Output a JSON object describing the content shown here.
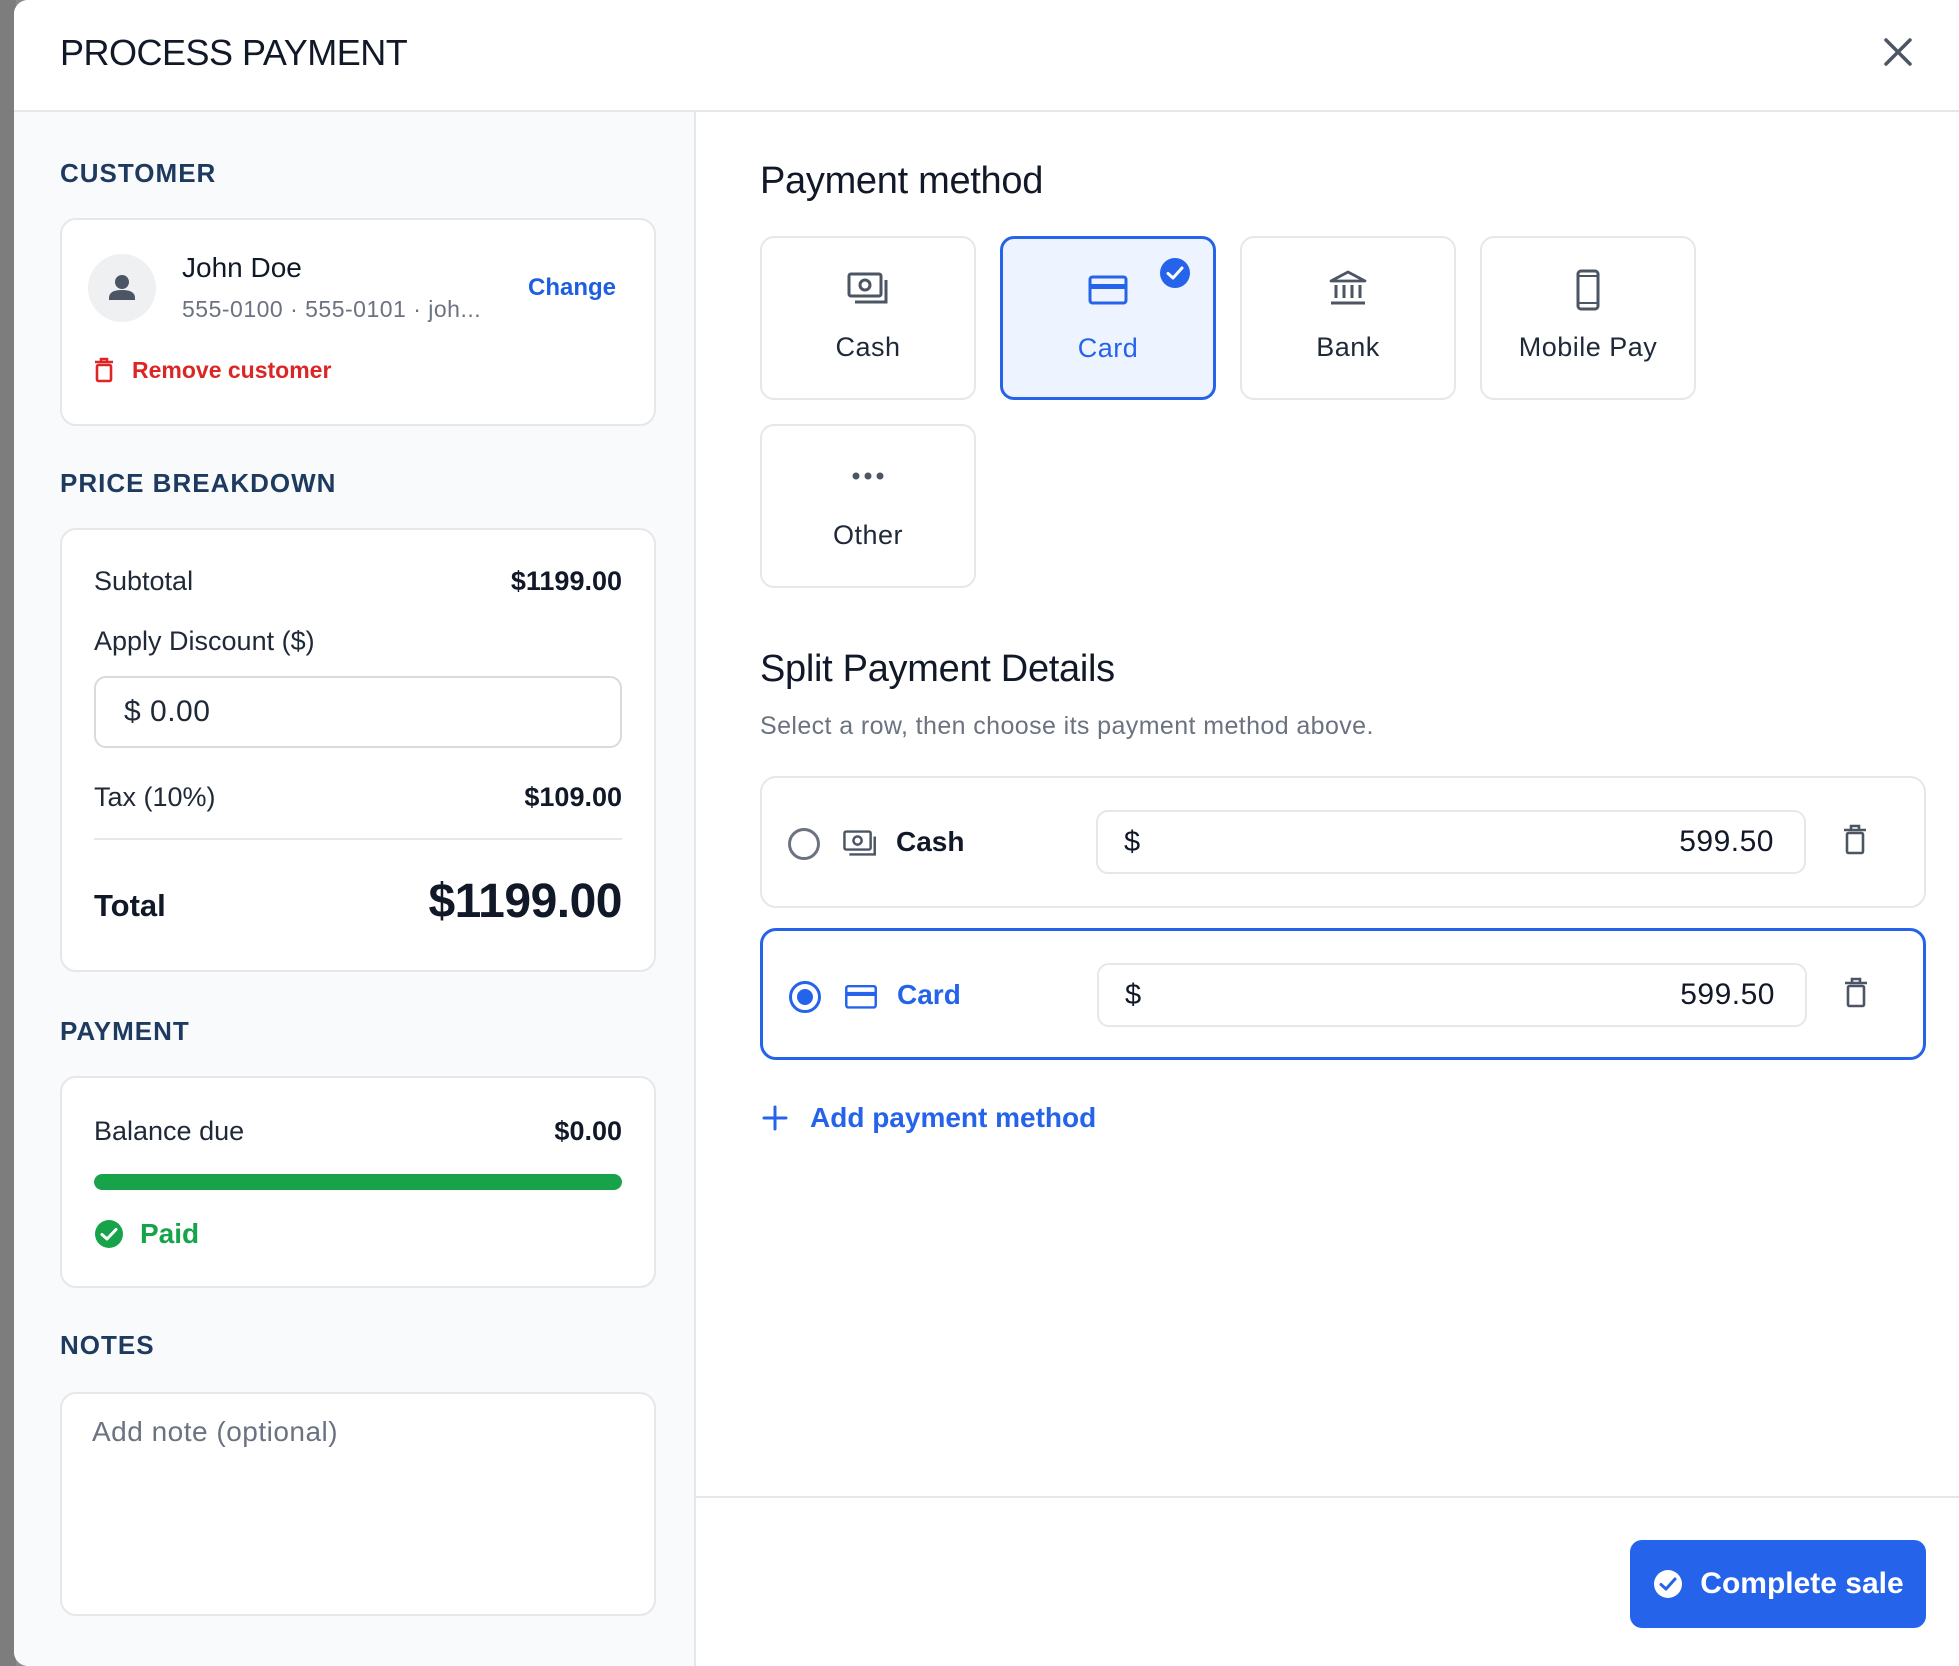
{
  "modal": {
    "title": "PROCESS PAYMENT"
  },
  "customer": {
    "section_label": "CUSTOMER",
    "name": "John Doe",
    "details": "555-0100 · 555-0101 · joh...",
    "change_label": "Change",
    "remove_label": "Remove customer"
  },
  "price_breakdown": {
    "section_label": "PRICE BREAKDOWN",
    "subtotal_label": "Subtotal",
    "subtotal_value": "$1199.00",
    "discount_label": "Apply Discount ($)",
    "discount_value": "$ 0.00",
    "tax_label": "Tax (10%)",
    "tax_value": "$109.00",
    "total_label": "Total",
    "total_value": "$1199.00"
  },
  "payment": {
    "section_label": "PAYMENT",
    "balance_label": "Balance due",
    "balance_value": "$0.00",
    "progress_percent": 100,
    "status_label": "Paid",
    "status_color": "#16a34a"
  },
  "notes": {
    "section_label": "NOTES",
    "placeholder": "Add note (optional)"
  },
  "payment_method": {
    "heading": "Payment method",
    "selected": "Card",
    "options": [
      {
        "label": "Cash",
        "icon": "cash-icon"
      },
      {
        "label": "Card",
        "icon": "credit-card-icon"
      },
      {
        "label": "Bank",
        "icon": "bank-icon"
      },
      {
        "label": "Mobile Pay",
        "icon": "mobile-phone-icon"
      },
      {
        "label": "Other",
        "icon": "more-horizontal-icon"
      }
    ]
  },
  "split": {
    "heading": "Split Payment Details",
    "hint": "Select a row, then choose its payment method above.",
    "rows": [
      {
        "method": "Cash",
        "currency": "$",
        "amount": "599.50",
        "selected": false
      },
      {
        "method": "Card",
        "currency": "$",
        "amount": "599.50",
        "selected": true
      }
    ],
    "add_label": "Add payment method"
  },
  "footer": {
    "complete_label": "Complete sale"
  },
  "colors": {
    "accent": "#2563eb",
    "danger": "#dc2626",
    "success": "#16a34a"
  }
}
